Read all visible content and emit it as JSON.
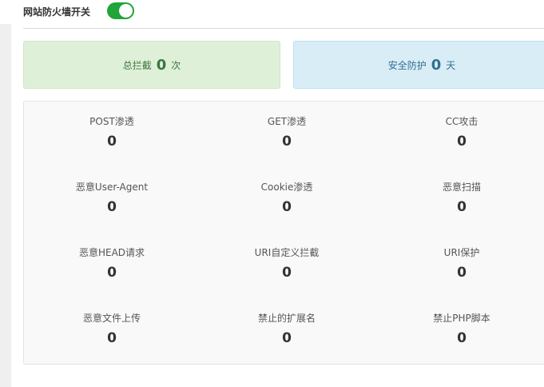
{
  "header": {
    "firewall_label": "网站防火墙开关",
    "firewall_enabled": true
  },
  "summary": {
    "blocked_label": "总拦截",
    "blocked_count": "0",
    "blocked_unit": "次",
    "protect_label": "安全防护",
    "protect_days": "0",
    "protect_unit": "天"
  },
  "stats": [
    {
      "name": "POST渗透",
      "value": "0"
    },
    {
      "name": "GET渗透",
      "value": "0"
    },
    {
      "name": "CC攻击",
      "value": "0"
    },
    {
      "name": "恶意User-Agent",
      "value": "0"
    },
    {
      "name": "Cookie渗透",
      "value": "0"
    },
    {
      "name": "恶意扫描",
      "value": "0"
    },
    {
      "name": "恶意HEAD请求",
      "value": "0"
    },
    {
      "name": "URI自定义拦截",
      "value": "0"
    },
    {
      "name": "URI保护",
      "value": "0"
    },
    {
      "name": "恶意文件上传",
      "value": "0"
    },
    {
      "name": "禁止的扩展名",
      "value": "0"
    },
    {
      "name": "禁止PHP脚本",
      "value": "0"
    }
  ],
  "colors": {
    "toggle_on": "#20a53a",
    "blocked_bg": "#dff0d8",
    "protect_bg": "#d9edf7"
  }
}
